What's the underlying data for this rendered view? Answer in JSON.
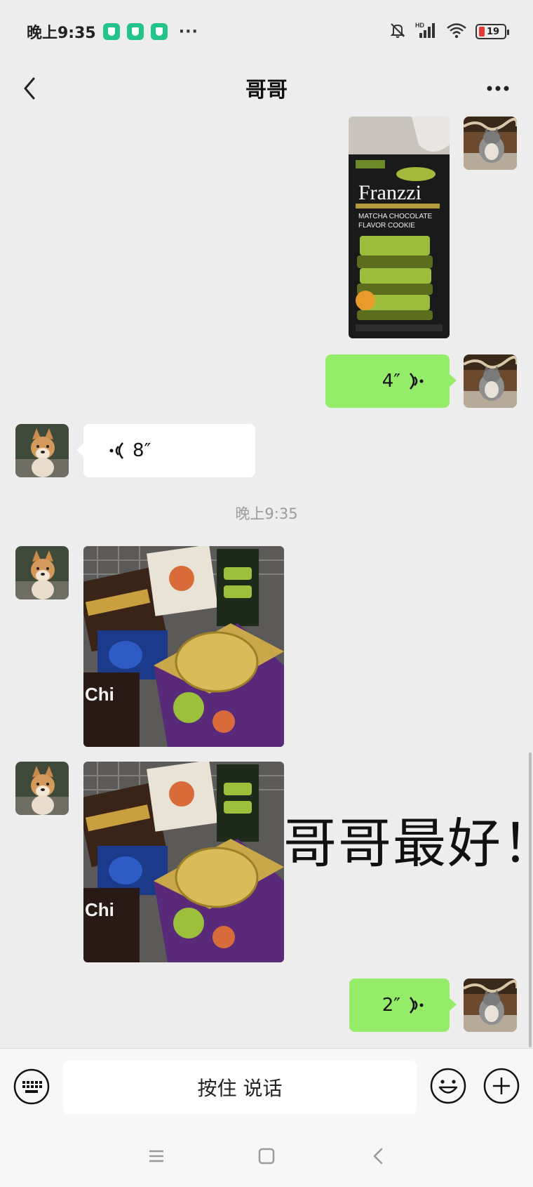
{
  "status_bar": {
    "time": "晚上9:35",
    "dots": "···",
    "battery_level": "19",
    "icons": [
      "shield-icon",
      "shield-icon",
      "shield-icon",
      "muted-bell-icon",
      "hd-signal-icon",
      "wifi-icon",
      "battery-icon"
    ]
  },
  "header": {
    "title": "哥哥",
    "back_icon": "chevron-left-icon",
    "more_icon": "more-icon"
  },
  "messages": [
    {
      "side": "right",
      "type": "image",
      "description_icon": "photo"
    },
    {
      "side": "right",
      "type": "voice",
      "duration": "4″"
    },
    {
      "side": "left",
      "type": "voice",
      "duration": "8″"
    },
    {
      "side": "center",
      "type": "timestamp",
      "text": "晚上9:35"
    },
    {
      "side": "left",
      "type": "image"
    },
    {
      "side": "left",
      "type": "image",
      "sticker_text": "哥哥最好！"
    },
    {
      "side": "right",
      "type": "voice",
      "duration": "2″"
    }
  ],
  "input_bar": {
    "hold_to_talk": "按住 说话",
    "keyboard_icon": "keyboard-icon",
    "emoji_icon": "emoji-icon",
    "plus_icon": "plus-icon"
  },
  "nav_bar": {
    "icons": [
      "menu-icon",
      "home-icon",
      "back-icon"
    ]
  },
  "colors": {
    "sent_bubble": "#95ec69",
    "received_bubble": "#ffffff",
    "background": "#ededed"
  }
}
